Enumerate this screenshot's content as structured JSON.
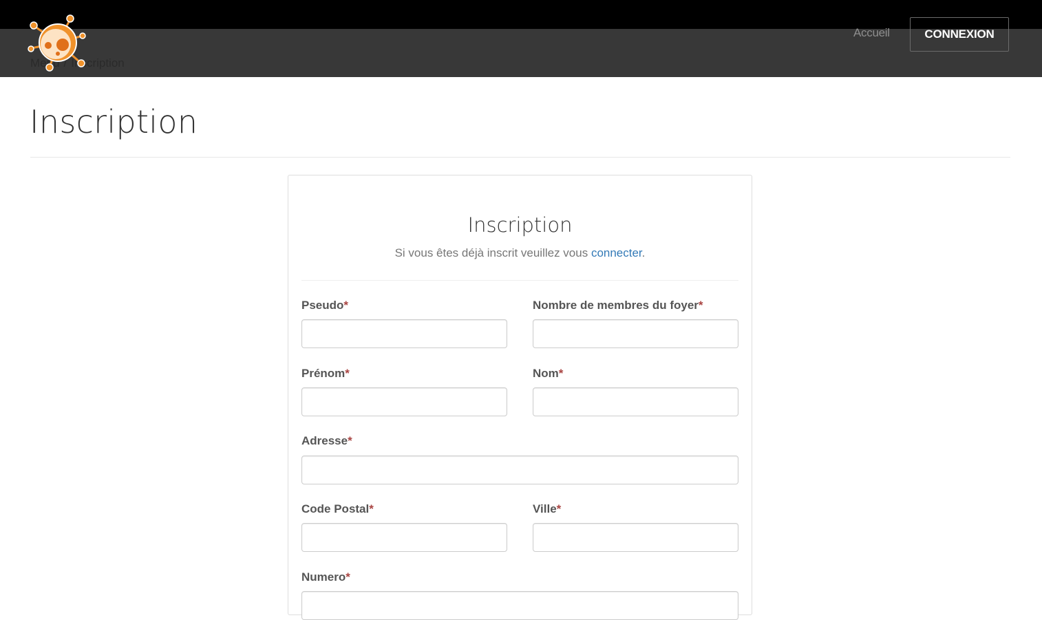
{
  "navbar": {
    "accueil_label": "Accueil",
    "connexion_label": "CONNEXION",
    "breadcrumb": [
      "Menu",
      "Inscription"
    ]
  },
  "page": {
    "title": "Inscription"
  },
  "card": {
    "title": "Inscription",
    "subtitle_before": "Si vous êtes déjà inscrit veuillez vous ",
    "subtitle_link": "connecter",
    "subtitle_after": "."
  },
  "form": {
    "pseudo": {
      "label": "Pseudo",
      "required": "*",
      "value": ""
    },
    "membres": {
      "label": "Nombre de membres du foyer",
      "required": "*",
      "value": ""
    },
    "prenom": {
      "label": "Prénom",
      "required": "*",
      "value": ""
    },
    "nom": {
      "label": "Nom",
      "required": "*",
      "value": ""
    },
    "adresse": {
      "label": "Adresse",
      "required": "*",
      "value": ""
    },
    "code_postal": {
      "label": "Code Postal",
      "required": "*",
      "value": ""
    },
    "ville": {
      "label": "Ville",
      "required": "*",
      "value": ""
    },
    "numero": {
      "label": "Numero",
      "required": "*",
      "value": ""
    }
  },
  "colors": {
    "navbar_bg": "#383838",
    "topstrip_bg": "#000000",
    "logo_orange": "#f0922b",
    "link_blue": "#337ab7",
    "required_red": "#a94442"
  },
  "icons": {
    "logo": "virus-logo-icon"
  }
}
